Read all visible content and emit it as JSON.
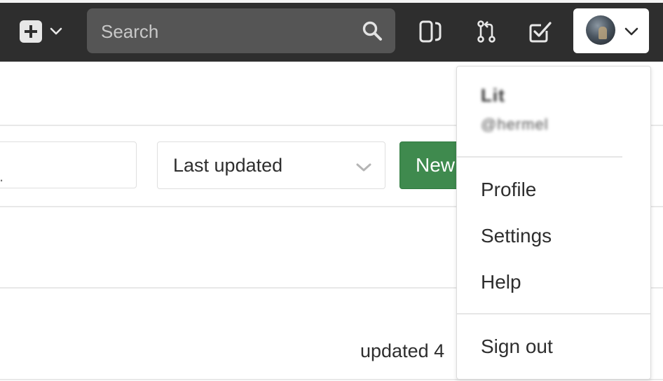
{
  "header": {
    "new_menu": {
      "icon": "plus-square-icon",
      "chevron": "chevron-down-icon"
    },
    "search": {
      "placeholder": "Search",
      "icon": "search-icon"
    },
    "nav_icons": [
      "issues-board-icon",
      "merge-request-icon",
      "todo-check-icon"
    ],
    "user_menu": {
      "avatar": "user-avatar",
      "chevron": "chevron-down-icon"
    }
  },
  "toolbar": {
    "sort_label": "Last updated",
    "new_button_label": "New"
  },
  "list": {
    "updated_text": "updated 4"
  },
  "dropdown": {
    "user_name": "Lit",
    "user_handle": "@hermel",
    "items": [
      "Profile",
      "Settings",
      "Help"
    ],
    "sign_out": "Sign out"
  },
  "colors": {
    "header_bg": "#2e2e2e",
    "search_bg": "#555555",
    "primary_button": "#3f8a4e"
  }
}
